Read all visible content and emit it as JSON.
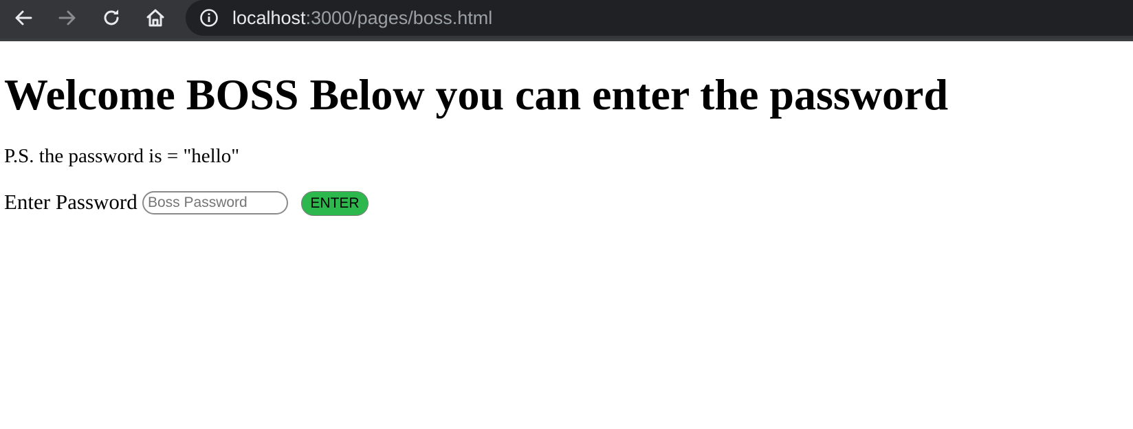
{
  "browser": {
    "url_host": "localhost",
    "url_path": ":3000/pages/boss.html",
    "icons": [
      "back-arrow-icon",
      "forward-arrow-icon",
      "reload-icon",
      "home-icon",
      "info-icon"
    ],
    "colors": {
      "toolbar": "#35363a",
      "omnibox": "#202124",
      "forward_disabled": "#8a8b8f",
      "icon": "#e8eaed"
    }
  },
  "page": {
    "title": "Welcome BOSS Below you can enter the password",
    "hint": "P.S. the password is = \"hello\"",
    "password_label": "Enter Password",
    "password_input": {
      "value": "",
      "placeholder": "Boss Password"
    },
    "enter_button_label": "ENTER",
    "colors": {
      "enter_button": "#2db84d"
    }
  }
}
